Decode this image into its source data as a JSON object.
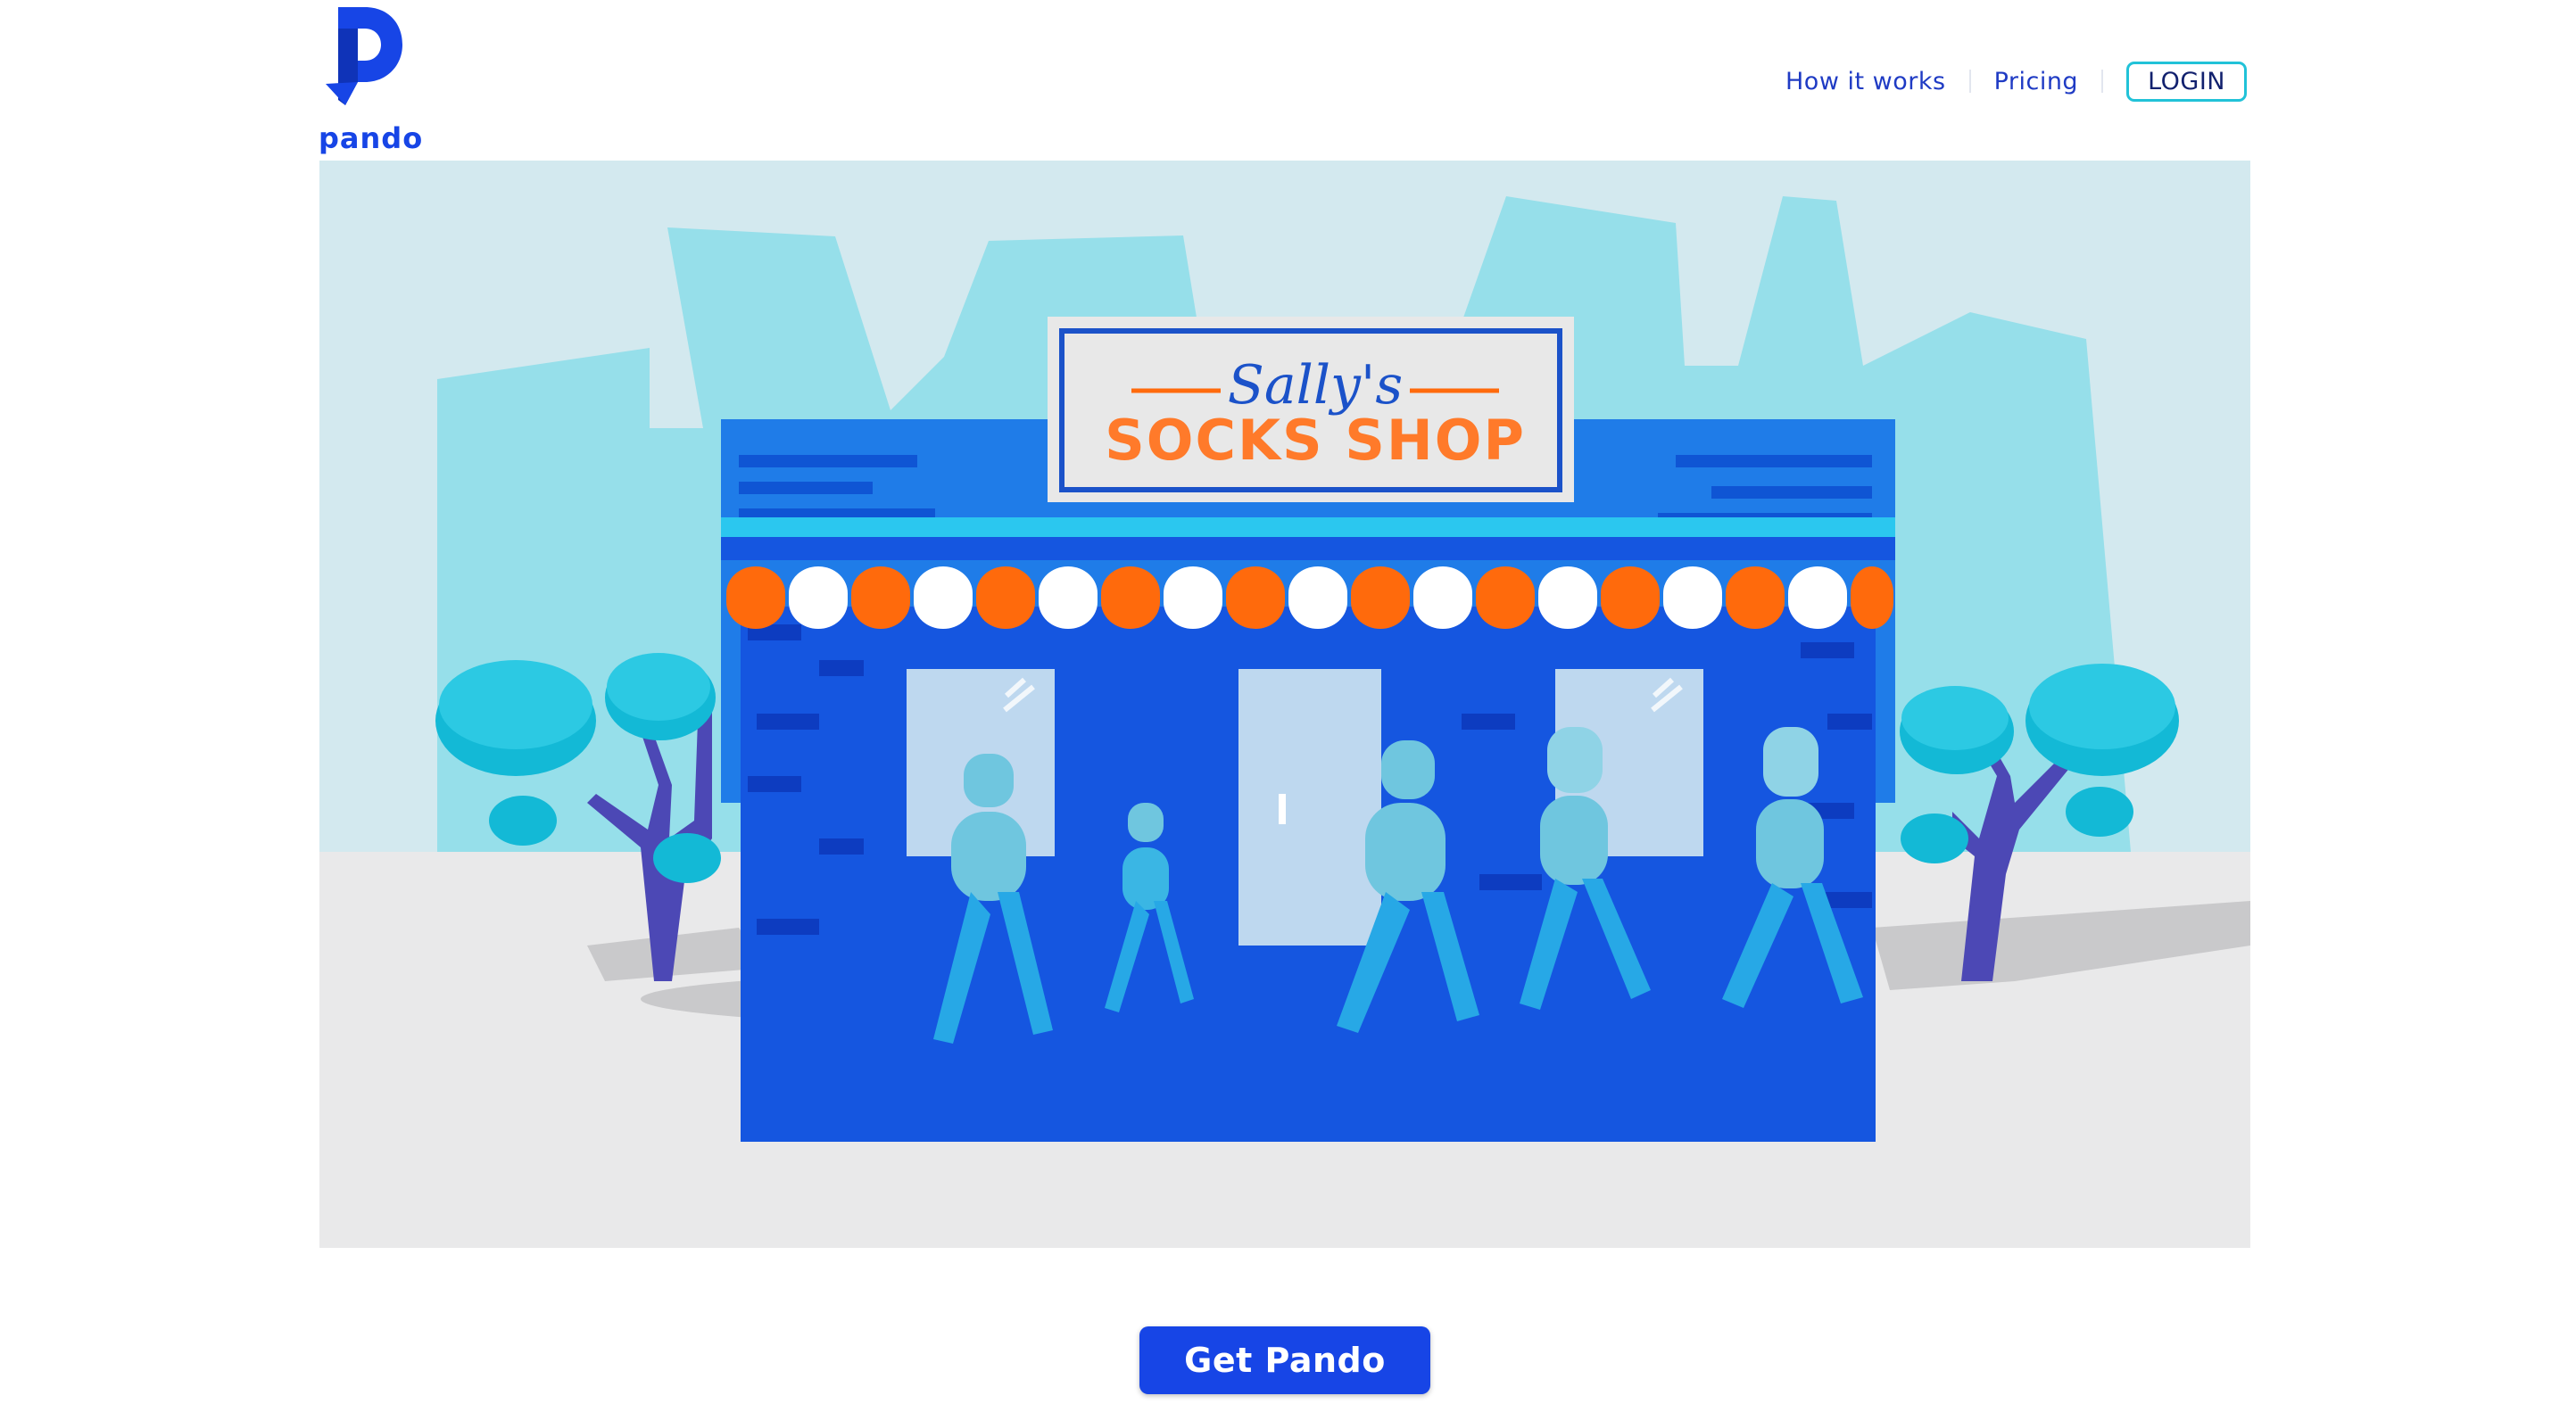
{
  "brand": {
    "name": "pando",
    "color": "#1745e6"
  },
  "nav": {
    "how_it_works": "How it works",
    "pricing": "Pricing",
    "login": "LOGIN"
  },
  "hero": {
    "sign_script": "Sally's",
    "sign_title": "SOCKS SHOP"
  },
  "cta": {
    "label": "Get Pando"
  },
  "colors": {
    "accent": "#1745e6",
    "login_border": "#21c2d8",
    "nav_text": "#1f3bc4",
    "awning_orange": "#ff6a0c"
  }
}
